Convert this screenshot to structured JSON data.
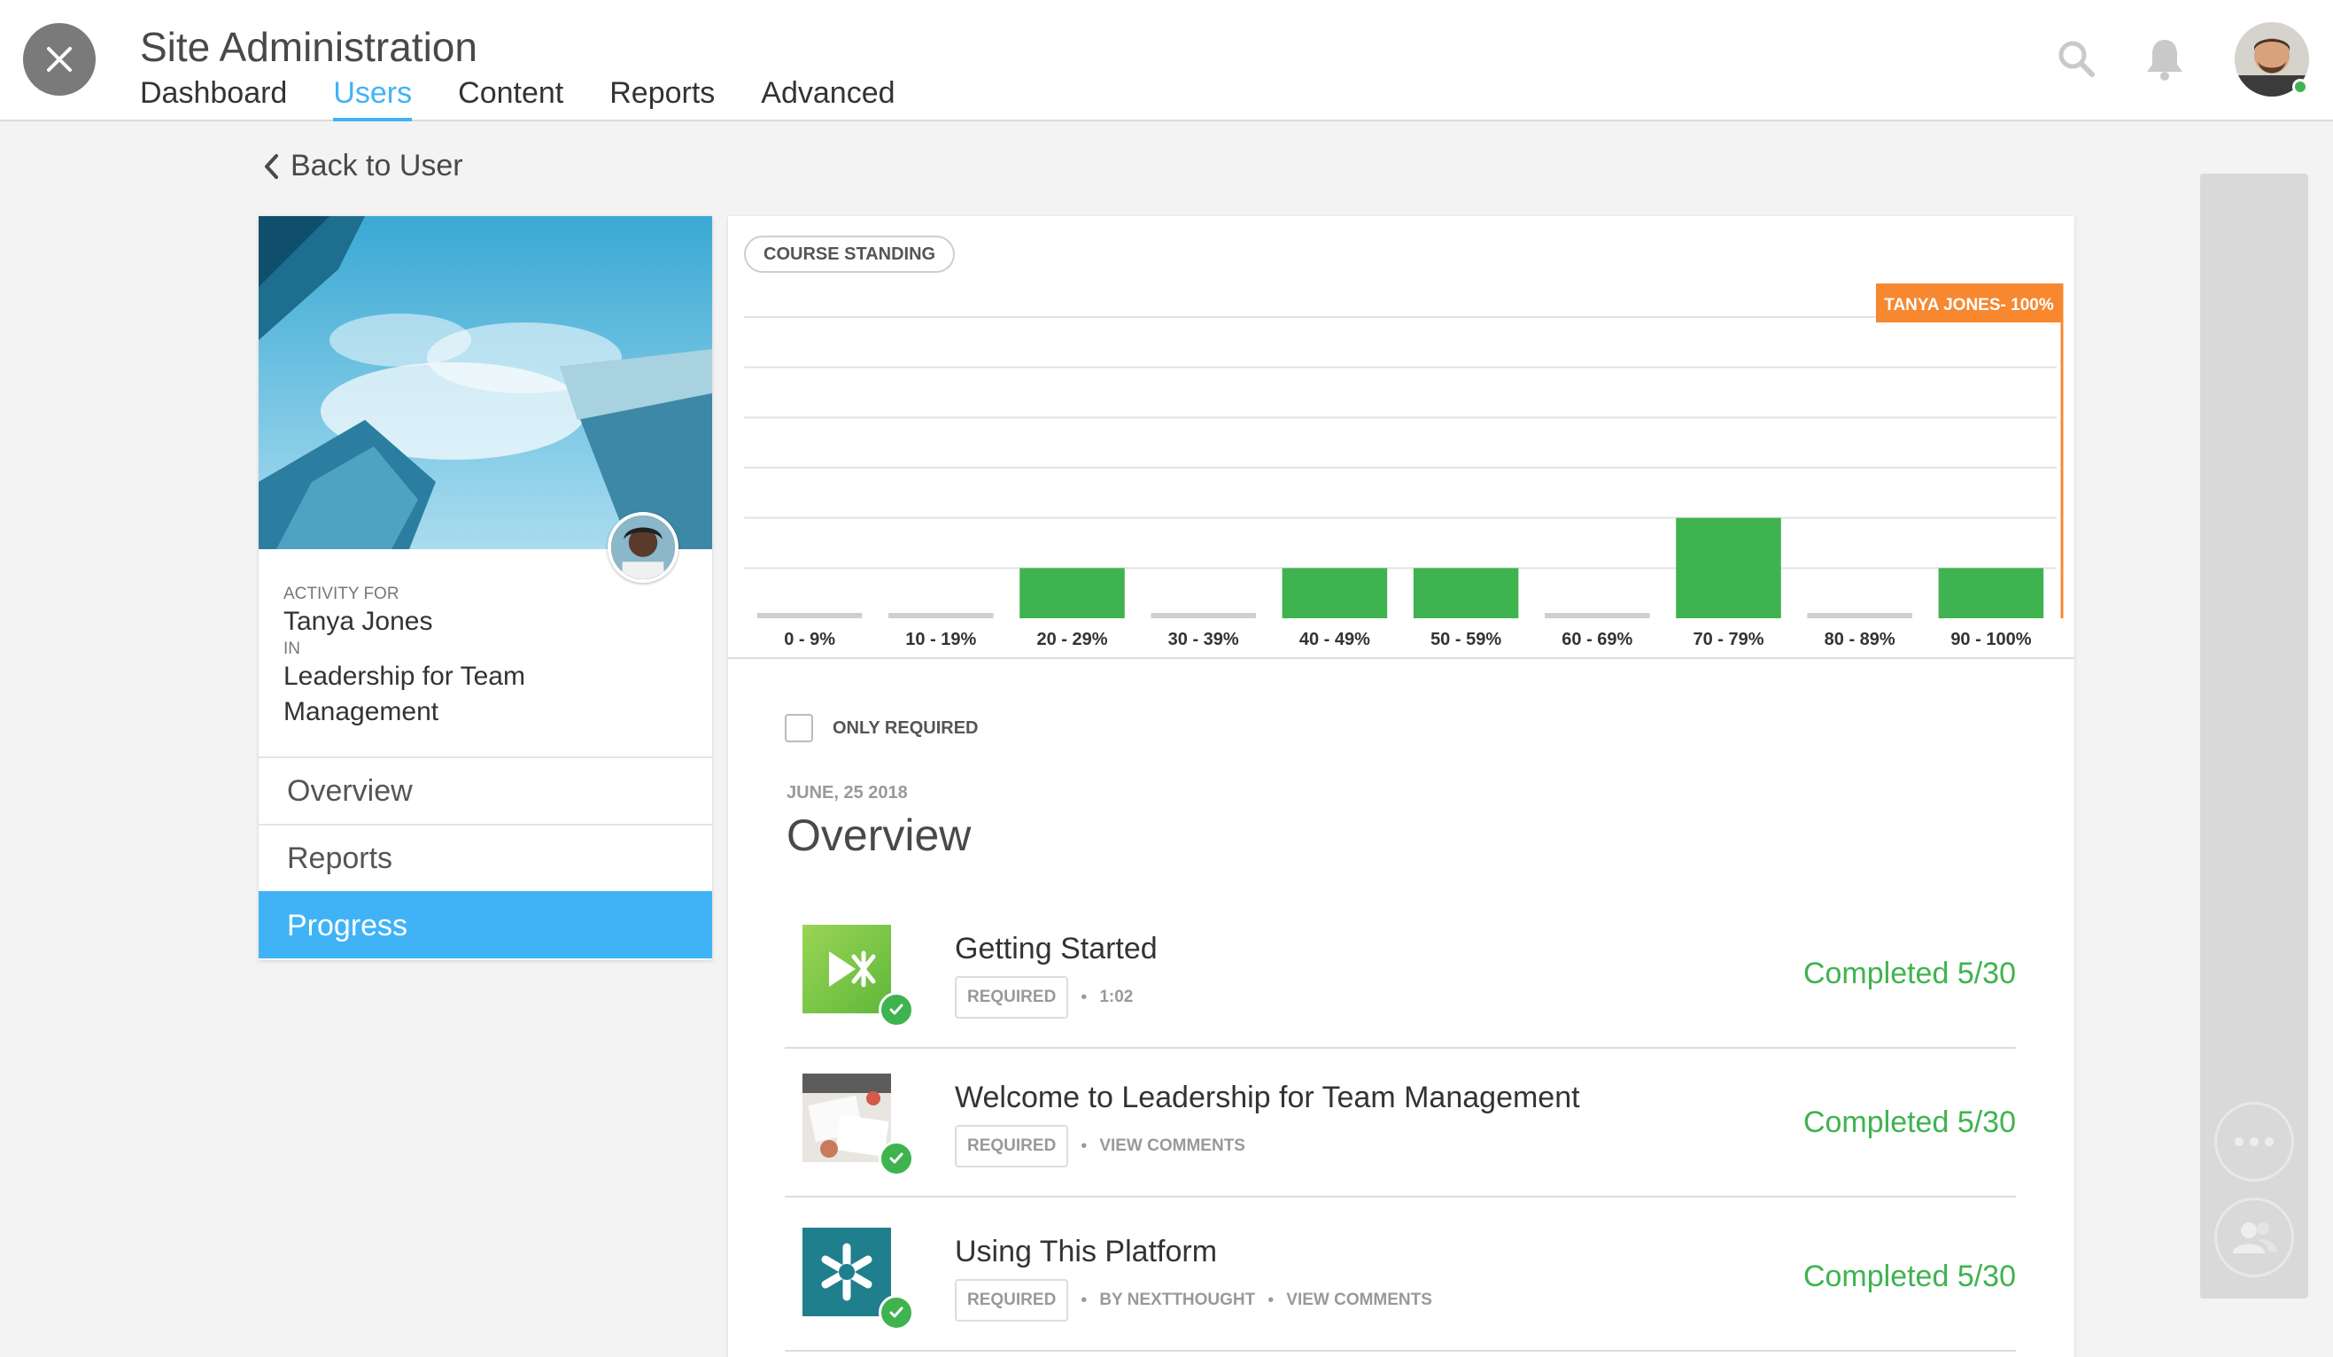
{
  "header": {
    "title": "Site Administration",
    "tabs": [
      {
        "label": "Dashboard",
        "active": false
      },
      {
        "label": "Users",
        "active": true
      },
      {
        "label": "Content",
        "active": false
      },
      {
        "label": "Reports",
        "active": false
      },
      {
        "label": "Advanced",
        "active": false
      }
    ],
    "icons": [
      "close-icon",
      "search-icon",
      "bell-icon",
      "user-avatar"
    ]
  },
  "back_link": "Back to User",
  "activity": {
    "for_label": "ACTIVITY FOR",
    "learner": "Tanya Jones",
    "in_label": "IN",
    "course": "Leadership for Team Management"
  },
  "side_menu": [
    {
      "label": "Overview",
      "active": false
    },
    {
      "label": "Reports",
      "active": false
    },
    {
      "label": "Progress",
      "active": true
    }
  ],
  "course_standing": {
    "pill_label": "COURSE STANDING",
    "marker_label": "TANYA JONES- 100%"
  },
  "chart_data": {
    "type": "bar",
    "categories": [
      "0 - 9%",
      "10 - 19%",
      "20 - 29%",
      "30 - 39%",
      "40 - 49%",
      "50 - 59%",
      "60 - 69%",
      "70 - 79%",
      "80 - 89%",
      "90 - 100%"
    ],
    "values": [
      0,
      0,
      1,
      0,
      1,
      1,
      0,
      2,
      0,
      1
    ],
    "ylim": [
      0,
      6
    ],
    "grid": true,
    "highlight": {
      "label": "TANYA JONES- 100%",
      "category": "90 - 100%"
    },
    "colors": {
      "bar": "#3fb34f",
      "empty": "#cfcfcf",
      "marker": "#f7882f"
    }
  },
  "filter": {
    "only_required": "ONLY REQUIRED",
    "checked": false
  },
  "section": {
    "date": "JUNE, 25 2018",
    "title": "Overview"
  },
  "items": [
    {
      "title": "Getting Started",
      "badge": "REQUIRED",
      "meta": [
        "1:02"
      ],
      "status": "Completed 5/30",
      "thumb": "video-thumb"
    },
    {
      "title": "Welcome to Leadership for Team Management",
      "badge": "REQUIRED",
      "meta": [
        "VIEW COMMENTS"
      ],
      "status": "Completed 5/30",
      "thumb": "reading-thumb"
    },
    {
      "title": "Using This Platform",
      "badge": "REQUIRED",
      "meta": [
        "BY NEXTTHOUGHT",
        "VIEW COMMENTS"
      ],
      "status": "Completed 5/30",
      "thumb": "platform-thumb"
    }
  ],
  "colors": {
    "accent": "#3fb3f6",
    "success": "#3fb34f",
    "marker": "#f7882f"
  }
}
